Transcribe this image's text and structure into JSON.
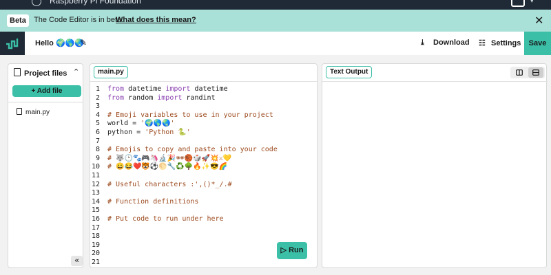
{
  "brand": "Raspberry Pi Foundation",
  "beta_banner": {
    "tag": "Beta",
    "message": "The Code Editor is in beta.",
    "link": "What does this mean?"
  },
  "header": {
    "project_name": "Hello 🌍🌎🌏",
    "download_label": "Download",
    "settings_label": "Settings",
    "save_label": "Save"
  },
  "sidebar": {
    "title": "Project files",
    "add_file_label": "+ Add file",
    "files": [
      "main.py"
    ],
    "collapse_glyph": "«"
  },
  "editor": {
    "tab_label": "main.py",
    "run_label": "▷ Run",
    "lines": [
      "from datetime import datetime",
      "from random import randint",
      "",
      "# Emoji variables to use in your project",
      "world = '🌍🌎🌏'",
      "python = 'Python 🐍'",
      "",
      "# Emojis to copy and paste into your code",
      "# 🐺🕒🐾🎮🦄🔬🎉🕶🏀🎲🚀💥⚔💛",
      "# 😀😂❤️🐯⚽🌕🔧♻️🌳🔥✨😎🌈",
      "",
      "# Useful characters :',()*_/.#",
      "",
      "# Function definitions",
      "",
      "# Put code to run under here",
      "",
      "",
      "",
      "",
      ""
    ]
  },
  "output": {
    "tab_label": "Text Output"
  },
  "colors": {
    "accent": "#3bbfa7",
    "banner": "#a9e0d8",
    "dark": "#1f2a36",
    "keyword": "#8a3fb0",
    "comment": "#9c4a1e"
  }
}
